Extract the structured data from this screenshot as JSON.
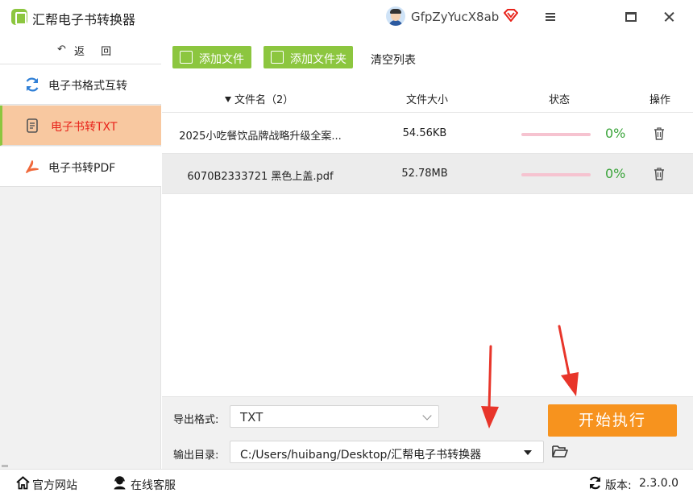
{
  "app": {
    "title": "汇帮电子书转换器",
    "username": "GfpZyYucX8ab",
    "icons": [
      "app-logo-icon",
      "avatar",
      "vip-diamond-icon",
      "menu-icon",
      "maximize-icon",
      "close-icon"
    ]
  },
  "sidebar": {
    "back_label": "返 回",
    "back_arrow": "↶",
    "items": [
      {
        "label": "电子书格式互转",
        "icon": "refresh-icon",
        "active": false
      },
      {
        "label": "电子书转TXT",
        "icon": "document-icon",
        "active": true
      },
      {
        "label": "电子书转PDF",
        "icon": "pdf-icon",
        "active": false
      }
    ]
  },
  "toolbar": {
    "add_file": "添加文件",
    "add_folder": "添加文件夹",
    "clear_list": "清空列表"
  },
  "table": {
    "headers": {
      "name": "文件名（2）",
      "size": "文件大小",
      "status": "状态",
      "action": "操作"
    },
    "rows": [
      {
        "name": "2025小吃餐饮品牌战略升级全案...",
        "size": "54.56KB",
        "progress": 0,
        "percent": "0%",
        "selected": false
      },
      {
        "name": "6070B2333721 黑色上盖.pdf",
        "size": "52.78MB",
        "progress": 0,
        "percent": "0%",
        "selected": true
      }
    ]
  },
  "bottom": {
    "format_label": "导出格式:",
    "format_value": "TXT",
    "dir_label": "输出目录:",
    "dir_value": "C:/Users/huibang/Desktop/汇帮电子书转换器",
    "start_button": "开始执行"
  },
  "statusbar": {
    "website": "官方网站",
    "support": "在线客服",
    "version_label": "版本:",
    "version": "2.3.0.0"
  },
  "colors": {
    "accent_green": "#8cc63f",
    "active_nav_bg": "#f8c8a0",
    "active_nav_text": "#e8231a",
    "start_orange": "#f7931e",
    "progress_pink": "#f6c3d0",
    "percent_green": "#3aa43a",
    "annotation_red": "#e8352a"
  }
}
